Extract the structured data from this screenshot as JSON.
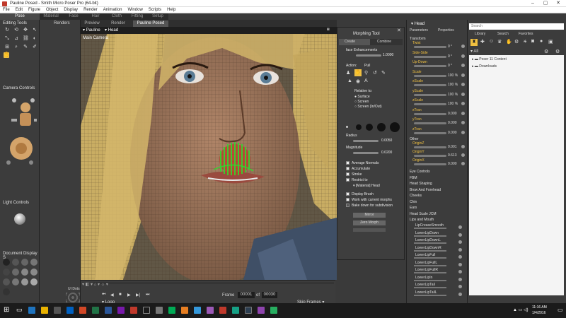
{
  "window": {
    "title": "Pauline Posed - Smith Micro Poser Pro  (64-bit)",
    "min": "–",
    "max": "▢",
    "close": "✕"
  },
  "menu": [
    "File",
    "Edit",
    "Figure",
    "Object",
    "Display",
    "Render",
    "Animation",
    "Window",
    "Scripts",
    "Help"
  ],
  "rooms": [
    "Pose",
    "Material",
    "Face",
    "Hair",
    "Cloth",
    "Fitting",
    "Setup"
  ],
  "left": {
    "editing_tools": "Editing Tools",
    "camera_controls": "Camera Controls",
    "light_controls": "Light Controls",
    "document_display": "Document Display S"
  },
  "renders": {
    "label": "Renders",
    "ui_dots": "UI Dots"
  },
  "view_tabs": [
    "Preview",
    "Render",
    "Pauline Posed"
  ],
  "viewport": {
    "figure": "Pauline",
    "part": "Head",
    "camera": "Main Camera"
  },
  "timeline": {
    "frame_label": "Frame",
    "frame": "00001",
    "of": "of",
    "total": "00030",
    "loop": "Loop",
    "skip_frames": "Skip Frames"
  },
  "morph": {
    "title": "Morphing Tool",
    "tab_create": "Create",
    "tab_combine": "Combine",
    "enhance": "face Enhancements",
    "enhance_val": "1.0000",
    "action": "Action:",
    "pull": "Pull",
    "relative": "Relative to:",
    "surface": "Surface",
    "screen": "Screen",
    "screen_inout": "Screen (In/Out)",
    "radius": "Radius",
    "radius_val": "0.0050",
    "magnitude": "Magnitude",
    "magnitude_val": "0.0200",
    "avg_normals": "Average Normals",
    "accumulate": "Accumulate",
    "stroke": "Stroke",
    "restrict": "Restrict to",
    "restrict_val": "[Material] Head",
    "display_brush": "Display Brush",
    "work_current": "Work with current morphs",
    "bake": "Bake down for subdivision",
    "mirror": "Mirror",
    "zero": "Zero Morph"
  },
  "params": {
    "title": "Head",
    "tab_params": "Parameters",
    "tab_props": "Properties",
    "transform": "Transform",
    "items": [
      {
        "n": "Twist",
        "v": "0 °"
      },
      {
        "n": "Side-Side",
        "v": "0 °"
      },
      {
        "n": "Up-Down",
        "v": "0 °"
      },
      {
        "n": "Scale",
        "v": "100 %"
      },
      {
        "n": "xScale",
        "v": "100 %"
      },
      {
        "n": "yScale",
        "v": "100 %"
      },
      {
        "n": "zScale",
        "v": "100 %"
      },
      {
        "n": "xTran",
        "v": "0.000"
      },
      {
        "n": "yTran",
        "v": "0.000"
      },
      {
        "n": "zTran",
        "v": "0.000"
      }
    ],
    "other": "Other",
    "other_items": [
      {
        "n": "OriginZ",
        "v": "0.001"
      },
      {
        "n": "OriginY",
        "v": "0.613"
      },
      {
        "n": "OriginX",
        "v": "0.000"
      }
    ],
    "groups": [
      "Eye Controls",
      "FBM",
      "Head Shaping",
      "Brow And Forehead",
      "Cheeks",
      "Chin",
      "Ears",
      "Head Scale JCM",
      "Lips and Mouth"
    ],
    "lips": [
      "LipCreaseSmooth",
      "LowerLipDown",
      "LowerLipDownL",
      "LowerLipDownR",
      "LowerLipFull",
      "LowerLipFullL",
      "LowerLipFullR",
      "LowerLipIn",
      "LowerLipTail",
      "LowerLipTailL"
    ]
  },
  "library": {
    "search_placeholder": "Search",
    "tab_library": "Library",
    "tab_search": "Search",
    "tab_favorites": "Favorites",
    "all": "All",
    "items": [
      "Poser 11 Content",
      "Downloads"
    ]
  },
  "taskbar": {
    "time": "11:16 AM",
    "date": "1/4/2016"
  },
  "colors": {
    "accent": "#f0c040",
    "panel": "#3c3c3c"
  }
}
